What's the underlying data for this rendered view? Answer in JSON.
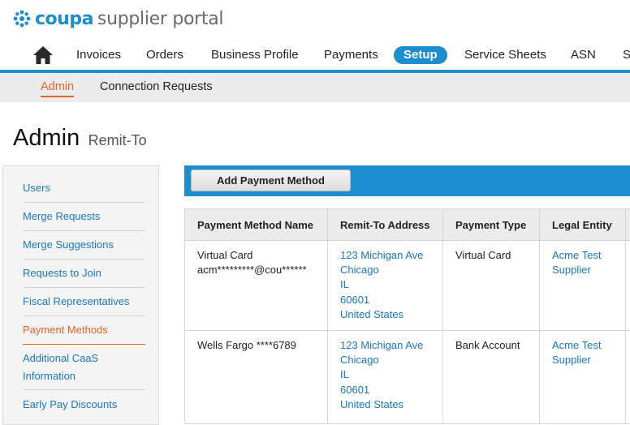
{
  "logo": {
    "brand": "coupa",
    "product": "supplier portal"
  },
  "colors": {
    "accent": "#1c8ed0",
    "active_orange": "#e5622a",
    "link": "#1a78c2"
  },
  "topnav": {
    "home_icon": "home-icon",
    "items": [
      {
        "label": "Invoices",
        "active": false
      },
      {
        "label": "Orders",
        "active": false
      },
      {
        "label": "Business Profile",
        "active": false
      },
      {
        "label": "Payments",
        "active": false
      },
      {
        "label": "Setup",
        "active": true
      },
      {
        "label": "Service Sheets",
        "active": false
      },
      {
        "label": "ASN",
        "active": false
      },
      {
        "label": "S",
        "active": false
      }
    ]
  },
  "subnav": {
    "items": [
      {
        "label": "Admin",
        "active": true
      },
      {
        "label": "Connection Requests",
        "active": false
      }
    ]
  },
  "page": {
    "title": "Admin",
    "subtitle": "Remit-To"
  },
  "sidebar": {
    "items": [
      {
        "label": "Users",
        "active": false
      },
      {
        "label": "Merge Requests",
        "active": false
      },
      {
        "label": "Merge Suggestions",
        "active": false
      },
      {
        "label": "Requests to Join",
        "active": false
      },
      {
        "label": "Fiscal Representatives",
        "active": false
      },
      {
        "label": "Payment Methods",
        "active": true
      },
      {
        "label": "Additional CaaS Information",
        "active": false
      },
      {
        "label": "Early Pay Discounts",
        "active": false
      }
    ]
  },
  "actions": {
    "add_payment_method": "Add Payment Method"
  },
  "table": {
    "columns": [
      "Payment Method Name",
      "Remit-To Address",
      "Payment Type",
      "Legal Entity"
    ],
    "rows": [
      {
        "name_line1": "Virtual Card",
        "name_line2": "acm*********@cou******",
        "address": [
          "123 Michigan Ave",
          "Chicago",
          "IL",
          "60601",
          "United States"
        ],
        "payment_type": "Virtual Card",
        "legal_entity": [
          "Acme Test",
          "Supplier"
        ]
      },
      {
        "name_line1": "Wells Fargo ****6789",
        "address": [
          "123 Michigan Ave",
          "Chicago",
          "IL",
          "60601",
          "United States"
        ],
        "payment_type": "Bank Account",
        "legal_entity": [
          "Acme Test",
          "Supplier"
        ]
      }
    ]
  }
}
